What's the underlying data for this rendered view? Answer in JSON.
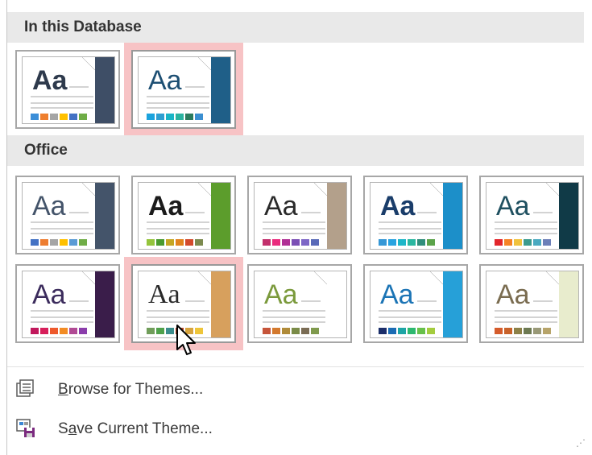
{
  "sections": {
    "database": {
      "title": "In this Database"
    },
    "office": {
      "title": "Office"
    }
  },
  "themes": {
    "database": [
      {
        "name": "database-theme-1",
        "aa": "Aa",
        "accent": "#3e4e66",
        "aa_color": "#2e3a4c",
        "aa_style": "sans-bold",
        "swatches": [
          "#3b8ed8",
          "#ef7f2e",
          "#a5a5a5",
          "#ffc000",
          "#4472c4",
          "#6fad47"
        ]
      },
      {
        "name": "database-theme-2",
        "aa": "Aa",
        "accent": "#1f5f88",
        "aa_color": "#1d4f73",
        "aa_style": "sans",
        "swatches": [
          "#1ba3dd",
          "#2e9fd1",
          "#19b5c6",
          "#2ab3a0",
          "#2b7b5d",
          "#3b8fd1"
        ]
      }
    ],
    "office": [
      {
        "name": "office-theme",
        "aa": "Aa",
        "accent": "#44546a",
        "aa_color": "#44546a",
        "aa_style": "sans",
        "swatches": [
          "#4472c4",
          "#ed7d31",
          "#a5a5a5",
          "#ffc000",
          "#5b9bd5",
          "#70ad47"
        ]
      },
      {
        "name": "facet-theme",
        "aa": "Aa",
        "accent": "#5c9d2c",
        "aa_color": "#1b1b1b",
        "aa_style": "sans-bold",
        "swatches": [
          "#94c43c",
          "#4a9a2e",
          "#c5a623",
          "#e2831e",
          "#d34a2c",
          "#7c8a4f"
        ]
      },
      {
        "name": "integral-theme",
        "aa": "Aa",
        "accent": "#b3a08b",
        "aa_color": "#2a2a2a",
        "aa_style": "sans",
        "swatches": [
          "#c2306c",
          "#ea2c7e",
          "#b02f95",
          "#7b4fb5",
          "#7d66c6",
          "#5a6ab8"
        ]
      },
      {
        "name": "ion-theme",
        "aa": "Aa",
        "accent": "#1c8fc9",
        "aa_color": "#1a3d6a",
        "aa_style": "sans-bold",
        "swatches": [
          "#3597d6",
          "#29a3e0",
          "#1db6c8",
          "#29b7a0",
          "#2f8e7b",
          "#5ba34a"
        ]
      },
      {
        "name": "ion-boardroom-theme",
        "aa": "Aa",
        "accent": "#103a47",
        "aa_color": "#1f5060",
        "aa_style": "sans",
        "swatches": [
          "#e2262c",
          "#f58326",
          "#f0c23d",
          "#3b9b8e",
          "#4aa9c0",
          "#6c7fb8"
        ]
      },
      {
        "name": "organic-theme",
        "aa": "Aa",
        "accent": "#3a1d4a",
        "aa_color": "#3b2b5c",
        "aa_style": "sans",
        "swatches": [
          "#c1185c",
          "#d71f5b",
          "#ee5a2d",
          "#f28c25",
          "#b04a94",
          "#8b3dab"
        ]
      },
      {
        "name": "retrospect-theme",
        "aa": "Aa",
        "accent": "#d7a05d",
        "aa_color": "#2a2a2a",
        "aa_style": "serif",
        "swatches": [
          "#709d5a",
          "#4fa14b",
          "#3b8d8c",
          "#b64325",
          "#d7a43d",
          "#eec53a"
        ]
      },
      {
        "name": "slice-theme",
        "aa": "Aa",
        "accent": "#ffffff",
        "aa_color": "#7b9a3c",
        "aa_style": "sans",
        "swatches": [
          "#c6553a",
          "#d3792e",
          "#b08b39",
          "#7a8b47",
          "#7a6c54",
          "#7f9a4d"
        ]
      },
      {
        "name": "wisp-theme",
        "aa": "Aa",
        "accent": "#26a0d8",
        "aa_color": "#1b74b5",
        "aa_style": "sans",
        "swatches": [
          "#1b2e6a",
          "#1c6cb4",
          "#1ea5a5",
          "#2db86f",
          "#68c04a",
          "#a4cc3e"
        ]
      },
      {
        "name": "banded-theme",
        "aa": "Aa",
        "accent": "#e8eccd",
        "aa_color": "#7a6c50",
        "aa_style": "sans",
        "swatches": [
          "#d55c2c",
          "#c8622a",
          "#8c8148",
          "#6d7a52",
          "#999977",
          "#b7a46a"
        ]
      }
    ]
  },
  "menu": {
    "browse": {
      "label": "Browse for Themes...",
      "icon": "folder-icon"
    },
    "save": {
      "label": "Save Current Theme...",
      "icon": "save-theme-icon"
    }
  }
}
